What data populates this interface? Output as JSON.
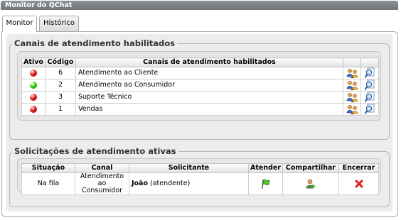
{
  "window": {
    "title": "Monitor do QChat"
  },
  "tabs": [
    {
      "label": "Monitor"
    },
    {
      "label": "Histórico"
    }
  ],
  "channels": {
    "legend": "Canais de atendimento habilitados",
    "headers": {
      "ativo": "Ativo",
      "codigo": "Código",
      "canal": "Canais de atendimento habilitados"
    },
    "rows": [
      {
        "status": "red",
        "codigo": "6",
        "nome": "Atendimento ao Cliente"
      },
      {
        "status": "green",
        "codigo": "2",
        "nome": "Atendimento ao Consumidor"
      },
      {
        "status": "red",
        "codigo": "3",
        "nome": "Suporte Técnico"
      },
      {
        "status": "red",
        "codigo": "1",
        "nome": "Vendas"
      }
    ],
    "row_icons": [
      "users-transfer-icon",
      "magnifier-document-icon"
    ]
  },
  "requests": {
    "legend": "Solicitações de atendimento ativas",
    "headers": {
      "situacao": "Situação",
      "canal": "Canal",
      "solicitante": "Solicitante",
      "atender": "Atender",
      "compartilhar": "Compartilhar",
      "encerrar": "Encerrar"
    },
    "rows": [
      {
        "situacao": "Na fila",
        "canal_l1": "Atendimento ao",
        "canal_l2": "Consumidor",
        "nome": "João",
        "papel": "(atendente)"
      }
    ],
    "icons": {
      "atender": "green-flag-icon",
      "compartilhar": "user-share-icon",
      "encerrar": "red-x-icon"
    }
  },
  "colors": {
    "active_status": "#3fcf1f",
    "inactive_status": "#e82020",
    "close": "#e01818"
  }
}
